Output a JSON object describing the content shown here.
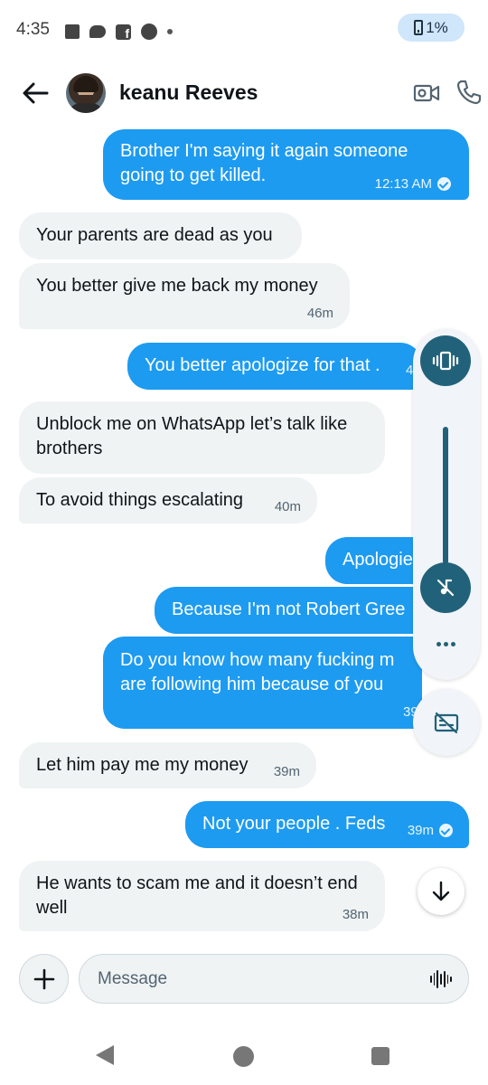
{
  "status_bar": {
    "time": "4:35",
    "battery": "1%",
    "icons": [
      "square-icon",
      "chat-bubble-icon",
      "facebook-icon",
      "circle-icon",
      "dot-icon"
    ]
  },
  "header": {
    "contact_name": "keanu Reeves"
  },
  "messages": [
    {
      "dir": "out",
      "text": "Brother I'm saying it again someone going to get killed.",
      "time": "12:13 AM",
      "read": true
    },
    {
      "dir": "in",
      "text": "Your parents are dead as you",
      "time": ""
    },
    {
      "dir": "in",
      "text": "You better give me back my money",
      "time": "46m"
    },
    {
      "dir": "out",
      "text": "You better apologize for that .",
      "time": "4",
      "read": false
    },
    {
      "dir": "in",
      "text": "Unblock me on WhatsApp let’s talk like brothers",
      "time": ""
    },
    {
      "dir": "in",
      "text": "To avoid things escalating",
      "time": "40m"
    },
    {
      "dir": "out",
      "text": "Apologie",
      "time": ""
    },
    {
      "dir": "out",
      "text": "Because I'm not Robert Gree",
      "time": ""
    },
    {
      "dir": "out",
      "text": "Do you know how many fucking m are following him because of you",
      "time": "39",
      "read": false
    },
    {
      "dir": "in",
      "text": "Let him pay me my money",
      "time": "39m"
    },
    {
      "dir": "out",
      "text": "Not your people . Feds",
      "time": "39m",
      "read": true
    },
    {
      "dir": "in",
      "text": "He wants to scam me and it doesn’t end well",
      "time": "38m"
    }
  ],
  "composer": {
    "placeholder": "Message",
    "value": ""
  },
  "colors": {
    "outgoing_bubble": "#1d9bf0",
    "incoming_bubble": "#eff3f4",
    "volume_accent": "#21627a",
    "battery_pill": "#cfe6fb"
  }
}
